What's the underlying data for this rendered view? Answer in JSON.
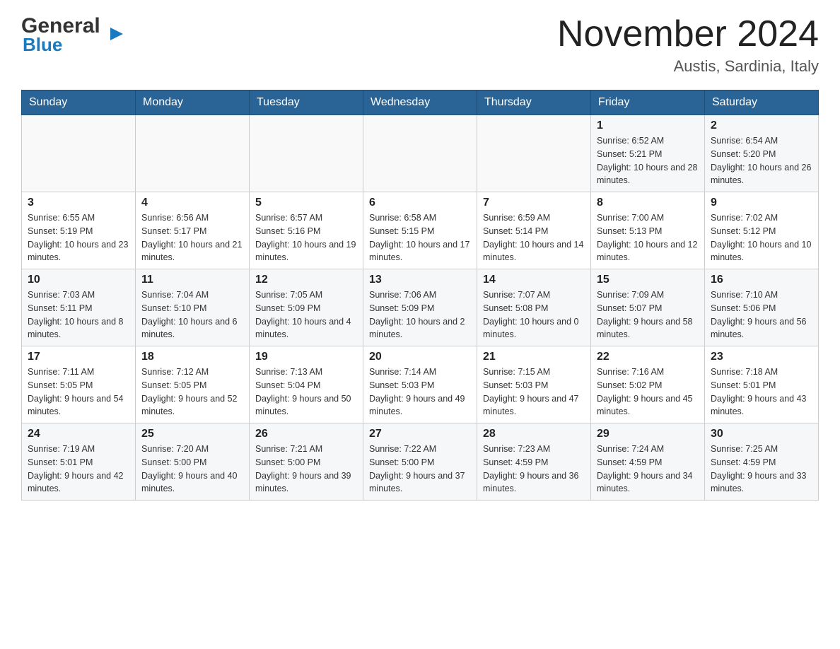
{
  "header": {
    "logo_general": "General",
    "logo_blue": "Blue",
    "title": "November 2024",
    "subtitle": "Austis, Sardinia, Italy"
  },
  "weekdays": [
    "Sunday",
    "Monday",
    "Tuesday",
    "Wednesday",
    "Thursday",
    "Friday",
    "Saturday"
  ],
  "weeks": [
    {
      "days": [
        {
          "num": "",
          "info": ""
        },
        {
          "num": "",
          "info": ""
        },
        {
          "num": "",
          "info": ""
        },
        {
          "num": "",
          "info": ""
        },
        {
          "num": "",
          "info": ""
        },
        {
          "num": "1",
          "info": "Sunrise: 6:52 AM\nSunset: 5:21 PM\nDaylight: 10 hours and 28 minutes."
        },
        {
          "num": "2",
          "info": "Sunrise: 6:54 AM\nSunset: 5:20 PM\nDaylight: 10 hours and 26 minutes."
        }
      ]
    },
    {
      "days": [
        {
          "num": "3",
          "info": "Sunrise: 6:55 AM\nSunset: 5:19 PM\nDaylight: 10 hours and 23 minutes."
        },
        {
          "num": "4",
          "info": "Sunrise: 6:56 AM\nSunset: 5:17 PM\nDaylight: 10 hours and 21 minutes."
        },
        {
          "num": "5",
          "info": "Sunrise: 6:57 AM\nSunset: 5:16 PM\nDaylight: 10 hours and 19 minutes."
        },
        {
          "num": "6",
          "info": "Sunrise: 6:58 AM\nSunset: 5:15 PM\nDaylight: 10 hours and 17 minutes."
        },
        {
          "num": "7",
          "info": "Sunrise: 6:59 AM\nSunset: 5:14 PM\nDaylight: 10 hours and 14 minutes."
        },
        {
          "num": "8",
          "info": "Sunrise: 7:00 AM\nSunset: 5:13 PM\nDaylight: 10 hours and 12 minutes."
        },
        {
          "num": "9",
          "info": "Sunrise: 7:02 AM\nSunset: 5:12 PM\nDaylight: 10 hours and 10 minutes."
        }
      ]
    },
    {
      "days": [
        {
          "num": "10",
          "info": "Sunrise: 7:03 AM\nSunset: 5:11 PM\nDaylight: 10 hours and 8 minutes."
        },
        {
          "num": "11",
          "info": "Sunrise: 7:04 AM\nSunset: 5:10 PM\nDaylight: 10 hours and 6 minutes."
        },
        {
          "num": "12",
          "info": "Sunrise: 7:05 AM\nSunset: 5:09 PM\nDaylight: 10 hours and 4 minutes."
        },
        {
          "num": "13",
          "info": "Sunrise: 7:06 AM\nSunset: 5:09 PM\nDaylight: 10 hours and 2 minutes."
        },
        {
          "num": "14",
          "info": "Sunrise: 7:07 AM\nSunset: 5:08 PM\nDaylight: 10 hours and 0 minutes."
        },
        {
          "num": "15",
          "info": "Sunrise: 7:09 AM\nSunset: 5:07 PM\nDaylight: 9 hours and 58 minutes."
        },
        {
          "num": "16",
          "info": "Sunrise: 7:10 AM\nSunset: 5:06 PM\nDaylight: 9 hours and 56 minutes."
        }
      ]
    },
    {
      "days": [
        {
          "num": "17",
          "info": "Sunrise: 7:11 AM\nSunset: 5:05 PM\nDaylight: 9 hours and 54 minutes."
        },
        {
          "num": "18",
          "info": "Sunrise: 7:12 AM\nSunset: 5:05 PM\nDaylight: 9 hours and 52 minutes."
        },
        {
          "num": "19",
          "info": "Sunrise: 7:13 AM\nSunset: 5:04 PM\nDaylight: 9 hours and 50 minutes."
        },
        {
          "num": "20",
          "info": "Sunrise: 7:14 AM\nSunset: 5:03 PM\nDaylight: 9 hours and 49 minutes."
        },
        {
          "num": "21",
          "info": "Sunrise: 7:15 AM\nSunset: 5:03 PM\nDaylight: 9 hours and 47 minutes."
        },
        {
          "num": "22",
          "info": "Sunrise: 7:16 AM\nSunset: 5:02 PM\nDaylight: 9 hours and 45 minutes."
        },
        {
          "num": "23",
          "info": "Sunrise: 7:18 AM\nSunset: 5:01 PM\nDaylight: 9 hours and 43 minutes."
        }
      ]
    },
    {
      "days": [
        {
          "num": "24",
          "info": "Sunrise: 7:19 AM\nSunset: 5:01 PM\nDaylight: 9 hours and 42 minutes."
        },
        {
          "num": "25",
          "info": "Sunrise: 7:20 AM\nSunset: 5:00 PM\nDaylight: 9 hours and 40 minutes."
        },
        {
          "num": "26",
          "info": "Sunrise: 7:21 AM\nSunset: 5:00 PM\nDaylight: 9 hours and 39 minutes."
        },
        {
          "num": "27",
          "info": "Sunrise: 7:22 AM\nSunset: 5:00 PM\nDaylight: 9 hours and 37 minutes."
        },
        {
          "num": "28",
          "info": "Sunrise: 7:23 AM\nSunset: 4:59 PM\nDaylight: 9 hours and 36 minutes."
        },
        {
          "num": "29",
          "info": "Sunrise: 7:24 AM\nSunset: 4:59 PM\nDaylight: 9 hours and 34 minutes."
        },
        {
          "num": "30",
          "info": "Sunrise: 7:25 AM\nSunset: 4:59 PM\nDaylight: 9 hours and 33 minutes."
        }
      ]
    }
  ]
}
